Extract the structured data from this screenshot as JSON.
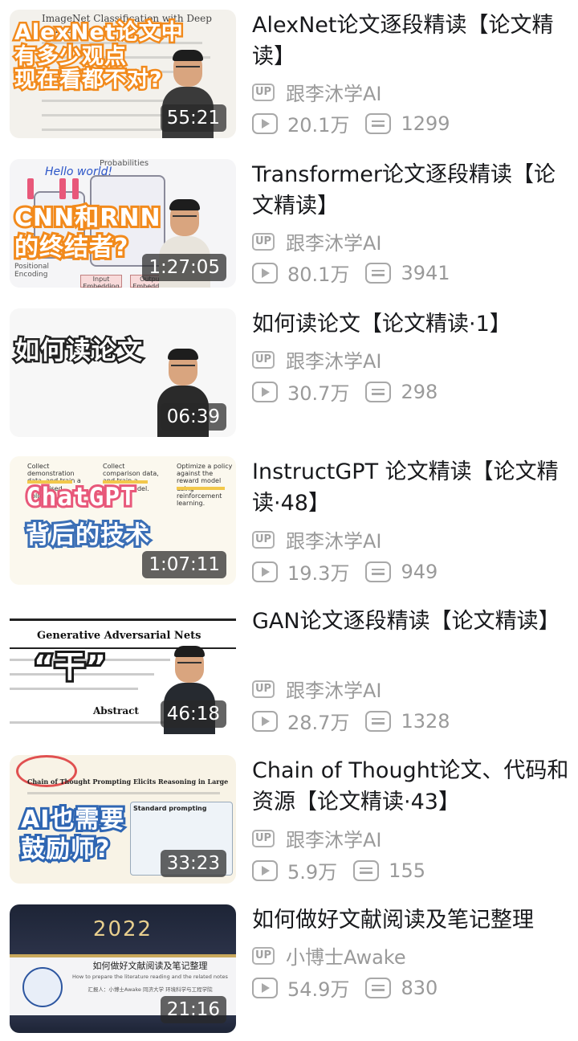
{
  "videos": [
    {
      "title": "AlexNet论文逐段精读【论文精读】",
      "uploader": "跟李沐学AI",
      "views": "20.1万",
      "danmaku": "1299",
      "duration": "55:21",
      "thumb_caption": "AlexNet论文中\n有多少观点\n现在看都不对?",
      "thumb_paper_title": "ImageNet Classification with Deep Convolutional"
    },
    {
      "title": "Transformer论文逐段精读【论文精读】",
      "uploader": "跟李沐学AI",
      "views": "80.1万",
      "danmaku": "3941",
      "duration": "1:27:05",
      "thumb_caption": "CNN和RNN\n的终结者?",
      "thumb_hello": "Hello world!",
      "thumb_labels": [
        "Probabilities",
        "Positional Encoding",
        "Positional Encoding",
        "Input Embedding",
        "Output Embedding"
      ]
    },
    {
      "title": "如何读论文【论文精读·1】",
      "uploader": "跟李沐学AI",
      "views": "30.7万",
      "danmaku": "298",
      "duration": "06:39",
      "thumb_caption": "如何读论文"
    },
    {
      "title": "InstructGPT 论文精读【论文精读·48】",
      "uploader": "跟李沐学AI",
      "views": "19.3万",
      "danmaku": "949",
      "duration": "1:07:11",
      "thumb_caption_1": "ChatGPT",
      "thumb_caption_2": "背后的技术",
      "thumb_steps": [
        "Collect demonstration data, and train a supervised policy.",
        "Collect comparison data, and train a reward model.",
        "Optimize a policy against the reward model using reinforcement learning."
      ]
    },
    {
      "title": "GAN论文逐段精读【论文精读】",
      "uploader": "跟李沐学AI",
      "views": "28.7万",
      "danmaku": "1328",
      "duration": "46:18",
      "thumb_caption": "“干”",
      "thumb_paper_title": "Generative Adversarial Nets",
      "thumb_abstract": "Abstract"
    },
    {
      "title": "Chain of Thought论文、代码和资源【论文精读·43】",
      "uploader": "跟李沐学AI",
      "views": "5.9万",
      "danmaku": "155",
      "duration": "33:23",
      "thumb_caption": "AI也需要\n鼓励师?",
      "thumb_paper_title": "Chain of Thought Prompting Elicits Reasoning in Large Language Models",
      "thumb_box_label": "Standard prompting"
    },
    {
      "title": "如何做好文献阅读及笔记整理",
      "uploader": "小博士Awake",
      "views": "54.9万",
      "danmaku": "830",
      "duration": "21:16",
      "thumb_year": "2022",
      "thumb_heading": "如何做好文献阅读及笔记整理",
      "thumb_subheading": "How to prepare the literature reading and the related notes",
      "thumb_reporter": "汇报人：小博士Awake    同济大学 环境科学与工程学院"
    }
  ],
  "labels": {
    "up_badge": "UP"
  },
  "colors": {
    "title": "#18191c",
    "meta": "#9a9a9a",
    "caption_orange": "#f28a1c",
    "caption_pink": "#e8587a"
  }
}
